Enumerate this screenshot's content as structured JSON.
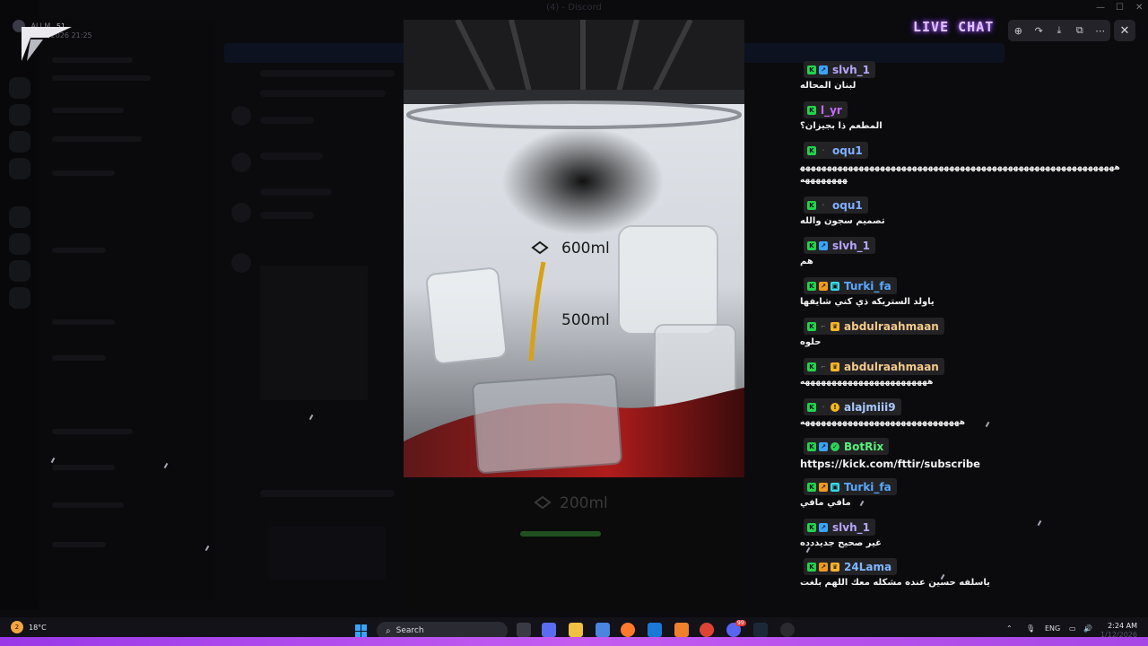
{
  "window": {
    "title": "(4) - Discord"
  },
  "user": {
    "name": "ALI M",
    "level": "51",
    "date": "1/12/2026 21:25"
  },
  "viewer": {
    "title": "LIVE CHAT",
    "toolbar": {
      "zoom_icon": "zoom-in-icon",
      "forward_icon": "forward-icon",
      "download_icon": "download-icon",
      "open_icon": "open-external-icon",
      "more_icon": "more-icon",
      "close_icon": "close-icon"
    },
    "photo": {
      "labels": {
        "600": "600ml",
        "500": "500ml",
        "200": "200ml"
      }
    }
  },
  "chat": {
    "messages": [
      {
        "user": "slvh_1",
        "color": "#b8a6ff",
        "badges": [
          "kick",
          "blue"
        ],
        "text": "لبنان المحاله"
      },
      {
        "user": "l_yr",
        "color": "#c46bff",
        "badges": [
          "kick"
        ],
        "text": "المطعم ذا بجيزان؟"
      },
      {
        "user": "oqu1",
        "color": "#7fb0ff",
        "badges": [
          "kick",
          "dim"
        ],
        "text": "ههههههههههههههههههههههههههههههههههههههههههههههههههههههههههههههههههههه"
      },
      {
        "user": "oqu1",
        "color": "#7fb0ff",
        "badges": [
          "kick",
          "dim"
        ],
        "text": "تصميم سجون والله"
      },
      {
        "user": "slvh_1",
        "color": "#b8a6ff",
        "badges": [
          "kick",
          "blue"
        ],
        "text": "هم"
      },
      {
        "user": "Turki_fa",
        "color": "#58a9ff",
        "badges": [
          "kick",
          "orange",
          "cyan"
        ],
        "text": "ياولد الستريكه ذي كني شايفها"
      },
      {
        "user": "abdulraahmaan",
        "color": "#f5c98a",
        "badges": [
          "kick",
          "dim",
          "sub"
        ],
        "text": "حلوه"
      },
      {
        "user": "abdulraahmaan",
        "color": "#f5c98a",
        "badges": [
          "kick",
          "dim",
          "sub"
        ],
        "text": "ههههههههههههههههههههههههه"
      },
      {
        "user": "alajmiii9",
        "color": "#a9c9ff",
        "badges": [
          "kick",
          "dim",
          "gold"
        ],
        "text": "ههههههههههههههههههههههههههههههه"
      },
      {
        "user": "BotRix",
        "color": "#5bf07a",
        "badges": [
          "kick",
          "blue",
          "green-check"
        ],
        "text": "https://kick.com/fttir/subscribe"
      },
      {
        "user": "Turki_fa",
        "color": "#58a9ff",
        "badges": [
          "kick",
          "orange",
          "cyan"
        ],
        "text": "مافي مافي"
      },
      {
        "user": "slvh_1",
        "color": "#b8a6ff",
        "badges": [
          "kick",
          "blue"
        ],
        "text": "غير صحيح جديددده"
      },
      {
        "user": "24Lama",
        "color": "#7fb8ff",
        "badges": [
          "kick",
          "orange",
          "sub"
        ],
        "text": "ياسلفه حسين عنده مشكله معك اللهم بلغت"
      }
    ]
  },
  "taskbar": {
    "weather": "18°C",
    "weather_badge": "2",
    "search_placeholder": "Search",
    "language": "ENG",
    "time": "2:24 AM",
    "date": "1/12/2026",
    "discord_badge": "99"
  }
}
